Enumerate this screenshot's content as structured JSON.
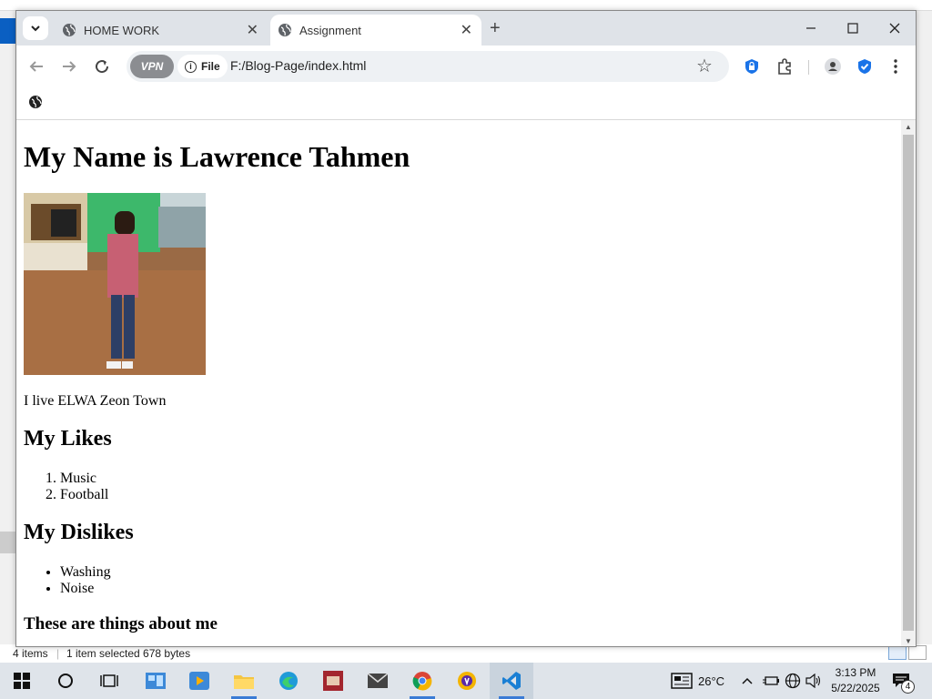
{
  "browser": {
    "tabs": [
      {
        "title": "HOME WORK"
      },
      {
        "title": "Assignment"
      }
    ],
    "vpn_label": "VPN",
    "file_chip": "File",
    "url": "F:/Blog-Page/index.html"
  },
  "page": {
    "heading": "My Name is Lawrence Tahmen",
    "location": "I live ELWA Zeon Town",
    "likes_heading": "My Likes",
    "likes": [
      "Music",
      "Football"
    ],
    "dislikes_heading": "My Dislikes",
    "dislikes": [
      "Washing",
      "Noise"
    ],
    "footer_heading": "These are things about me"
  },
  "explorer": {
    "item_count": "4 items",
    "selection": "1 item selected  678 bytes"
  },
  "taskbar": {
    "weather": "26°C",
    "time": "3:13 PM",
    "date": "5/22/2025",
    "notifications": "4"
  }
}
